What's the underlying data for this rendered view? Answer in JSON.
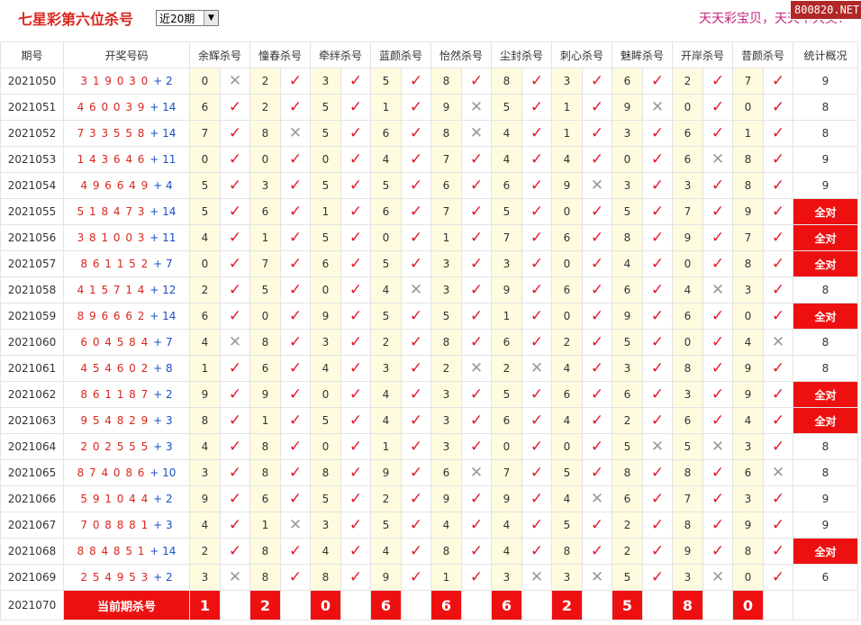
{
  "header": {
    "title": "七星彩第六位杀号",
    "period_select": "近20期",
    "slogan": "天天彩宝贝，天天中大奖！",
    "watermark": "800820.NET"
  },
  "columns": {
    "issue": "期号",
    "draw": "开奖号码",
    "experts": [
      "余辉杀号",
      "憧春杀号",
      "牵绊杀号",
      "蓝颜杀号",
      "怡然杀号",
      "尘封杀号",
      "刺心杀号",
      "魅眸杀号",
      "开岸杀号",
      "昔颜杀号"
    ],
    "stat": "统计概况"
  },
  "rows": [
    {
      "issue": "2021050",
      "main": "3 1 9 0 3 0",
      "bonus": "+ 2",
      "kills": [
        "0",
        "2",
        "3",
        "5",
        "8",
        "8",
        "3",
        "6",
        "2",
        "7"
      ],
      "hits": [
        false,
        true,
        true,
        true,
        true,
        true,
        true,
        true,
        true,
        true
      ],
      "stat": "9"
    },
    {
      "issue": "2021051",
      "main": "4 6 0 0 3 9",
      "bonus": "+ 14",
      "kills": [
        "6",
        "2",
        "5",
        "1",
        "9",
        "5",
        "1",
        "9",
        "0",
        "0"
      ],
      "hits": [
        true,
        true,
        true,
        true,
        false,
        true,
        true,
        false,
        true,
        true
      ],
      "stat": "8"
    },
    {
      "issue": "2021052",
      "main": "7 3 3 5 5 8",
      "bonus": "+ 14",
      "kills": [
        "7",
        "8",
        "5",
        "6",
        "8",
        "4",
        "1",
        "3",
        "6",
        "1"
      ],
      "hits": [
        true,
        false,
        true,
        true,
        false,
        true,
        true,
        true,
        true,
        true
      ],
      "stat": "8"
    },
    {
      "issue": "2021053",
      "main": "1 4 3 6 4 6",
      "bonus": "+ 11",
      "kills": [
        "0",
        "0",
        "0",
        "4",
        "7",
        "4",
        "4",
        "0",
        "6",
        "8"
      ],
      "hits": [
        true,
        true,
        true,
        true,
        true,
        true,
        true,
        true,
        false,
        true
      ],
      "stat": "9"
    },
    {
      "issue": "2021054",
      "main": "4 9 6 6 4 9",
      "bonus": "+ 4",
      "kills": [
        "5",
        "3",
        "5",
        "5",
        "6",
        "6",
        "9",
        "3",
        "3",
        "8"
      ],
      "hits": [
        true,
        true,
        true,
        true,
        true,
        true,
        false,
        true,
        true,
        true
      ],
      "stat": "9"
    },
    {
      "issue": "2021055",
      "main": "5 1 8 4 7 3",
      "bonus": "+ 14",
      "kills": [
        "5",
        "6",
        "1",
        "6",
        "7",
        "5",
        "0",
        "5",
        "7",
        "9"
      ],
      "hits": [
        true,
        true,
        true,
        true,
        true,
        true,
        true,
        true,
        true,
        true
      ],
      "stat": "全对"
    },
    {
      "issue": "2021056",
      "main": "3 8 1 0 0 3",
      "bonus": "+ 11",
      "kills": [
        "4",
        "1",
        "5",
        "0",
        "1",
        "7",
        "6",
        "8",
        "9",
        "7"
      ],
      "hits": [
        true,
        true,
        true,
        true,
        true,
        true,
        true,
        true,
        true,
        true
      ],
      "stat": "全对"
    },
    {
      "issue": "2021057",
      "main": "8 6 1 1 5 2",
      "bonus": "+ 7",
      "kills": [
        "0",
        "7",
        "6",
        "5",
        "3",
        "3",
        "0",
        "4",
        "0",
        "8"
      ],
      "hits": [
        true,
        true,
        true,
        true,
        true,
        true,
        true,
        true,
        true,
        true
      ],
      "stat": "全对"
    },
    {
      "issue": "2021058",
      "main": "4 1 5 7 1 4",
      "bonus": "+ 12",
      "kills": [
        "2",
        "5",
        "0",
        "4",
        "3",
        "9",
        "6",
        "6",
        "4",
        "3"
      ],
      "hits": [
        true,
        true,
        true,
        false,
        true,
        true,
        true,
        true,
        false,
        true
      ],
      "stat": "8"
    },
    {
      "issue": "2021059",
      "main": "8 9 6 6 6 2",
      "bonus": "+ 14",
      "kills": [
        "6",
        "0",
        "9",
        "5",
        "5",
        "1",
        "0",
        "9",
        "6",
        "0"
      ],
      "hits": [
        true,
        true,
        true,
        true,
        true,
        true,
        true,
        true,
        true,
        true
      ],
      "stat": "全对"
    },
    {
      "issue": "2021060",
      "main": "6 0 4 5 8 4",
      "bonus": "+ 7",
      "kills": [
        "4",
        "8",
        "3",
        "2",
        "8",
        "6",
        "2",
        "5",
        "0",
        "4"
      ],
      "hits": [
        false,
        true,
        true,
        true,
        true,
        true,
        true,
        true,
        true,
        false
      ],
      "stat": "8"
    },
    {
      "issue": "2021061",
      "main": "4 5 4 6 0 2",
      "bonus": "+ 8",
      "kills": [
        "1",
        "6",
        "4",
        "3",
        "2",
        "2",
        "4",
        "3",
        "8",
        "9"
      ],
      "hits": [
        true,
        true,
        true,
        true,
        false,
        false,
        true,
        true,
        true,
        true
      ],
      "stat": "8"
    },
    {
      "issue": "2021062",
      "main": "8 6 1 1 8 7",
      "bonus": "+ 2",
      "kills": [
        "9",
        "9",
        "0",
        "4",
        "3",
        "5",
        "6",
        "6",
        "3",
        "9"
      ],
      "hits": [
        true,
        true,
        true,
        true,
        true,
        true,
        true,
        true,
        true,
        true
      ],
      "stat": "全对"
    },
    {
      "issue": "2021063",
      "main": "9 5 4 8 2 9",
      "bonus": "+ 3",
      "kills": [
        "8",
        "1",
        "5",
        "4",
        "3",
        "6",
        "4",
        "2",
        "6",
        "4"
      ],
      "hits": [
        true,
        true,
        true,
        true,
        true,
        true,
        true,
        true,
        true,
        true
      ],
      "stat": "全对"
    },
    {
      "issue": "2021064",
      "main": "2 0 2 5 5 5",
      "bonus": "+ 3",
      "kills": [
        "4",
        "8",
        "0",
        "1",
        "3",
        "0",
        "0",
        "5",
        "5",
        "3"
      ],
      "hits": [
        true,
        true,
        true,
        true,
        true,
        true,
        true,
        false,
        false,
        true
      ],
      "stat": "8"
    },
    {
      "issue": "2021065",
      "main": "8 7 4 0 8 6",
      "bonus": "+ 10",
      "kills": [
        "3",
        "8",
        "8",
        "9",
        "6",
        "7",
        "5",
        "8",
        "8",
        "6"
      ],
      "hits": [
        true,
        true,
        true,
        true,
        false,
        true,
        true,
        true,
        true,
        false
      ],
      "stat": "8"
    },
    {
      "issue": "2021066",
      "main": "5 9 1 0 4 4",
      "bonus": "+ 2",
      "kills": [
        "9",
        "6",
        "5",
        "2",
        "9",
        "9",
        "4",
        "6",
        "7",
        "3"
      ],
      "hits": [
        true,
        true,
        true,
        true,
        true,
        true,
        false,
        true,
        true,
        true
      ],
      "stat": "9"
    },
    {
      "issue": "2021067",
      "main": "7 0 8 8 8 1",
      "bonus": "+ 3",
      "kills": [
        "4",
        "1",
        "3",
        "5",
        "4",
        "4",
        "5",
        "2",
        "8",
        "9"
      ],
      "hits": [
        true,
        false,
        true,
        true,
        true,
        true,
        true,
        true,
        true,
        true
      ],
      "stat": "9"
    },
    {
      "issue": "2021068",
      "main": "8 8 4 8 5 1",
      "bonus": "+ 14",
      "kills": [
        "2",
        "8",
        "4",
        "4",
        "8",
        "4",
        "8",
        "2",
        "9",
        "8"
      ],
      "hits": [
        true,
        true,
        true,
        true,
        true,
        true,
        true,
        true,
        true,
        true
      ],
      "stat": "全对"
    },
    {
      "issue": "2021069",
      "main": "2 5 4 9 5 3",
      "bonus": "+ 2",
      "kills": [
        "3",
        "8",
        "8",
        "9",
        "1",
        "3",
        "3",
        "5",
        "3",
        "0"
      ],
      "hits": [
        false,
        true,
        true,
        true,
        true,
        false,
        false,
        true,
        false,
        true
      ],
      "stat": "6"
    }
  ],
  "current": {
    "issue": "2021070",
    "label": "当前期杀号",
    "kills": [
      "1",
      "2",
      "0",
      "6",
      "6",
      "6",
      "2",
      "5",
      "8",
      "0"
    ]
  },
  "icons": {
    "hit": "check-icon",
    "miss": "cross-icon"
  },
  "colors": {
    "accent": "#ee1010",
    "number_bg": "#fefbdf",
    "hit": "#e0192a",
    "miss": "#9a9a9a"
  }
}
